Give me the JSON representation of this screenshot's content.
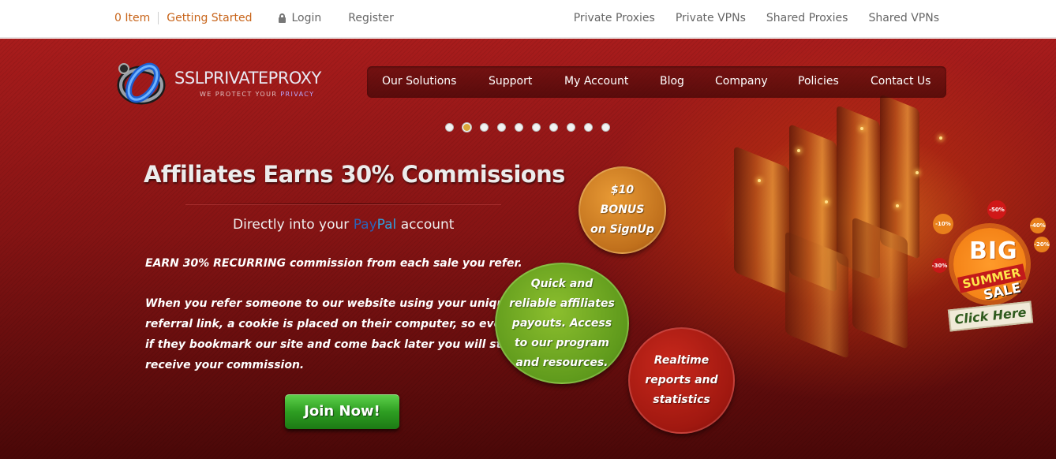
{
  "topbar": {
    "cart": "0 Item",
    "getting_started": "Getting Started",
    "login": "Login",
    "register": "Register",
    "links": [
      "Private Proxies",
      "Private VPNs",
      "Shared Proxies",
      "Shared VPNs"
    ]
  },
  "logo": {
    "name": "SSLPRIVATEPROXY",
    "tagline_pre": "WE PROTECT YOUR",
    "tagline_hl": "PRIVACY"
  },
  "nav": [
    "Our Solutions",
    "Support",
    "My Account",
    "Blog",
    "Company",
    "Policies",
    "Contact Us"
  ],
  "slider": {
    "count": 10,
    "active_index": 1
  },
  "slide": {
    "headline": "Affiliates Earns 30% Commissions",
    "sub_pre": "Directly into your",
    "sub_pay": "Pay",
    "sub_pal": "Pal",
    "sub_post": "account",
    "line1": "EARN 30% RECURRING commission from each sale you refer.",
    "para": [
      "When you refer someone to our website using your unique",
      "referral link, a cookie is placed on their computer, so even",
      "if they bookmark our site and come back later you will still",
      "receive your commission."
    ],
    "join": "Join Now!"
  },
  "circles": {
    "bonus": "$10\nBONUS\non SignUp",
    "payout": "Quick and\nreliable affiliates\npayouts. Access\nto our program\nand resources.",
    "reports": "Realtime\nreports and\nstatistics"
  },
  "sale": {
    "big": "BIG",
    "summer": "SUMMER",
    "sale": "SALE",
    "click": "Click Here",
    "tags": [
      "-10%",
      "-50%",
      "-40%",
      "-30%",
      "-20%"
    ]
  },
  "colors": {
    "accent_orange": "#c8651b",
    "hero_red": "#a81c1c",
    "join_green": "#2e9e22"
  }
}
